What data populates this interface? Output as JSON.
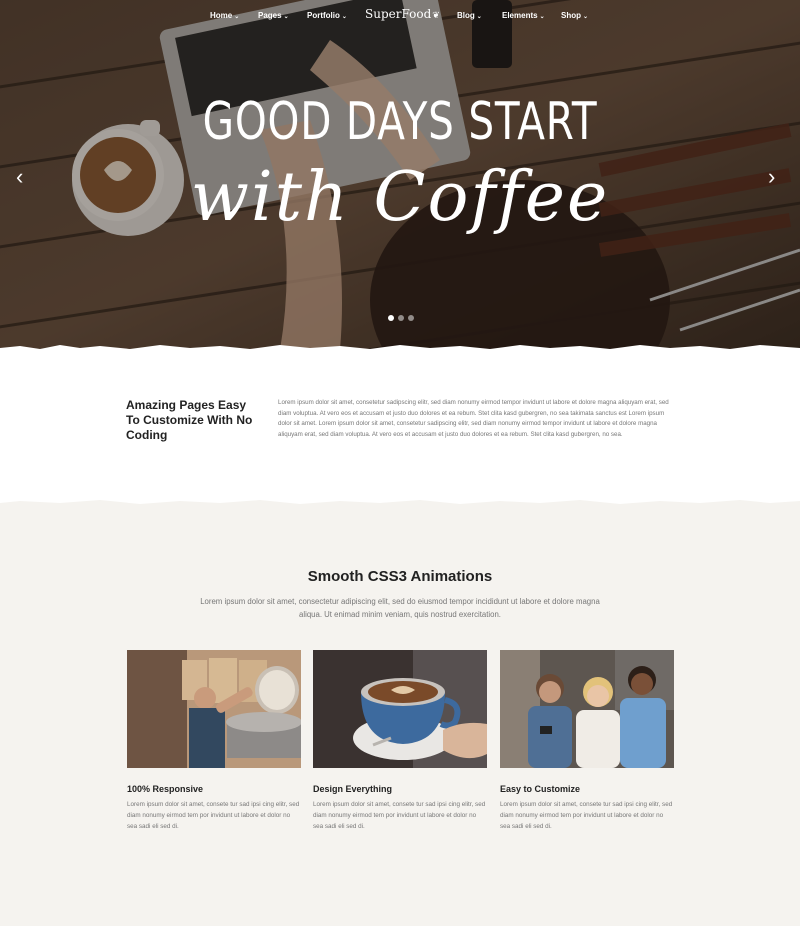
{
  "nav": {
    "items_left": [
      {
        "label": "Home"
      },
      {
        "label": "Pages"
      },
      {
        "label": "Portfolio"
      }
    ],
    "logo": "SuperFood",
    "items_right": [
      {
        "label": "Blog"
      },
      {
        "label": "Elements"
      },
      {
        "label": "Shop"
      }
    ]
  },
  "hero": {
    "line1": "GOOD DAYS START",
    "line2": "with Coffee",
    "slide_index": 1,
    "slide_count": 3
  },
  "intro": {
    "heading": "Amazing Pages Easy To Customize With No Coding",
    "body": "Lorem ipsum dolor sit amet, consetetur sadipscing elitr, sed diam nonumy eirmod tempor invidunt ut labore et dolore magna aliquyam erat, sed diam voluptua. At vero eos et accusam et justo duo dolores et ea rebum. Stet clita kasd gubergren, no sea takimata sanctus est Lorem ipsum dolor sit amet. Lorem ipsum dolor sit amet, consetetur sadipscing elitr, sed diam nonumy eirmod tempor invidunt ut labore et dolore magna aliquyam erat, sed diam voluptua. At vero eos et accusam et justo duo dolores et ea rebum. Stet clita kasd gubergren, no sea."
  },
  "features": {
    "title": "Smooth CSS3 Animations",
    "subtitle": "Lorem ipsum dolor sit amet, consectetur adipiscing elit, sed do eiusmod tempor incididunt ut labore et dolore magna aliqua. Ut enimad minim veniam, quis nostrud exercitation.",
    "cards": [
      {
        "title": "100% Responsive",
        "body": "Lorem ipsum dolor sit amet, consete tur sad ipsi cing elitr, sed diam nonumy eirmod tem por invidunt ut labore et dolor no sea sadi eli sed di."
      },
      {
        "title": "Design Everything",
        "body": "Lorem ipsum dolor sit amet, consete tur sad ipsi cing elitr, sed diam nonumy eirmod tem por invidunt ut labore et dolor no sea sadi eli sed di."
      },
      {
        "title": "Easy to Customize",
        "body": "Lorem ipsum dolor sit amet, consete tur sad ipsi cing elitr, sed diam nonumy eirmod tem por invidunt ut labore et dolor no sea sadi eli sed di."
      }
    ]
  },
  "colors": {
    "hero_dark": "#3d3129",
    "page_bg": "#f5f3ef",
    "heading": "#222222",
    "body_text": "#777777"
  },
  "icons": [
    "chevron-left-icon",
    "chevron-right-icon",
    "chevron-down-icon",
    "leaf-icon"
  ]
}
